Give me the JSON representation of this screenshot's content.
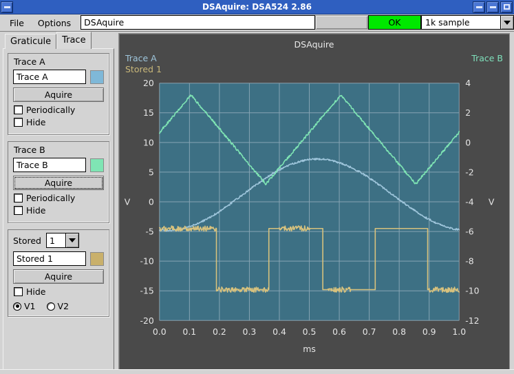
{
  "window": {
    "title": "DSAquire: DSA524 2.86",
    "buttons": {
      "system": "window-menu",
      "minimize": "minimize",
      "restore": "restore",
      "maximize": "maximize"
    }
  },
  "menubar": {
    "items": [
      {
        "label": "File"
      },
      {
        "label": "Options"
      }
    ]
  },
  "toolbar": {
    "name_field_value": "DSAquire",
    "name_field_placeholder": "",
    "blank_field_value": "",
    "status_button_label": "OK",
    "status_button_color": "#00e800",
    "sample_combo_value": "1k sample",
    "sample_combo_options": [
      "1k sample"
    ]
  },
  "tabs": [
    {
      "label": "Graticule",
      "active": false
    },
    {
      "label": "Trace",
      "active": true
    }
  ],
  "panels": {
    "trace_a": {
      "title": "Trace A",
      "field_value": "Trace A",
      "color": "#7fb8d8",
      "acquire_label": "Aquire",
      "periodically_label": "Periodically",
      "periodically_checked": false,
      "hide_label": "Hide",
      "hide_checked": false
    },
    "trace_b": {
      "title": "Trace B",
      "field_value": "Trace B",
      "color": "#7fe5b4",
      "acquire_label": "Aquire",
      "periodically_label": "Periodically",
      "periodically_checked": false,
      "hide_label": "Hide",
      "hide_checked": false
    },
    "stored": {
      "label": "Stored",
      "index_value": "1",
      "index_options": [
        "1"
      ],
      "field_value": "Stored 1",
      "color": "#c9b06b",
      "acquire_label": "Aquire",
      "hide_label": "Hide",
      "hide_checked": false,
      "v1_label": "V1",
      "v2_label": "V2",
      "selected_voltage": "V1"
    }
  },
  "plot_labels": {
    "title": "DSAquire",
    "trace_a": "Trace A",
    "stored_1": "Stored 1",
    "trace_b": "Trace B"
  },
  "chart_data": {
    "type": "line",
    "title": "DSAquire",
    "xlabel": "ms",
    "ylabel": "V",
    "ylabel_right": "V",
    "xlim": [
      0.0,
      1.0
    ],
    "ylim": [
      -20,
      20
    ],
    "ylim_right": [
      -12,
      4
    ],
    "xticks": [
      "0.0",
      "0.1",
      "0.2",
      "0.3",
      "0.4",
      "0.5",
      "0.6",
      "0.7",
      "0.8",
      "0.9",
      "1.0"
    ],
    "yticks_left": [
      "20",
      "15",
      "10",
      "5",
      "0",
      "-5",
      "-10",
      "-15",
      "-20"
    ],
    "yticks_right": [
      "4",
      "2",
      "0",
      "-2",
      "-4",
      "-6",
      "-8",
      "-10",
      "-12"
    ],
    "grid": true,
    "legend_position": "top-corners",
    "background": "#3d7084",
    "grid_color": "#9fb6c4",
    "plot_bg": "#4a4a4a",
    "series": [
      {
        "name": "Trace A",
        "color": "#9fc6dc",
        "axis": "left",
        "shape": "sine",
        "description": "Noisy sine wave, period 1.0 ms, amplitude 6 V, offset 1 V, starting near -5 V rising to +7 V at 0.45 ms then falling to -4 V",
        "amplitude": 6.0,
        "offset": 1.2,
        "period_ms": 1.0,
        "phase_deg": -100,
        "noise": 0.15
      },
      {
        "name": "Trace B",
        "color": "#7fe5b4",
        "axis": "left",
        "shape": "triangle",
        "description": "Noisy triangle wave, period 0.5 ms, peaks +18 V at 0.105 and 0.605 ms, troughs +3 V at 0.355 and 0.855 ms, starting at 11 V",
        "peak": 18.0,
        "trough": 3.0,
        "period_ms": 0.5,
        "peak_positions_ms": [
          0.105,
          0.605
        ],
        "trough_positions_ms": [
          0.355,
          0.855
        ],
        "start_value": 11.0,
        "noise": 0.2
      },
      {
        "name": "Stored 1",
        "color": "#d8c27d",
        "axis": "left",
        "shape": "square",
        "description": "Noisy square wave, high level -4.5 V, low level -14.8 V, period ~0.355 ms, transitions at 0.19, 0.365, 0.545, 0.72, 0.895 ms",
        "high": -4.5,
        "low": -14.8,
        "transitions_ms": [
          0.19,
          0.365,
          0.545,
          0.72,
          0.895
        ],
        "noise_segments": [
          [
            0.0,
            0.19
          ],
          [
            0.19,
            0.365
          ],
          [
            0.4,
            0.5
          ],
          [
            0.56,
            0.64
          ],
          [
            0.9,
            1.0
          ]
        ],
        "noise": 0.45
      }
    ]
  }
}
